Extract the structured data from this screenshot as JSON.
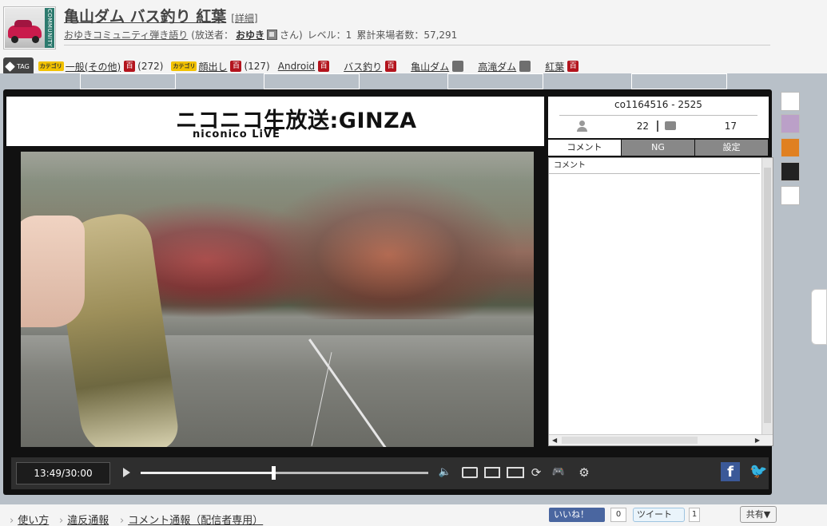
{
  "header": {
    "title": "亀山ダム バス釣り 紅葉",
    "detail_link": "[詳細]",
    "community_name": "おゆきコミュニティ弾き語り",
    "broadcaster_label": "(放送者：",
    "broadcaster_name": "おゆき",
    "broadcaster_suffix": "さん)",
    "level_text": "レベル：1",
    "visitors_text": "累計来場者数：57,291",
    "thumb_band": "COMMUNITY"
  },
  "tags": {
    "tag_label": "TAG",
    "category_badge": "カテゴリ",
    "dict_glyph": "百",
    "items": [
      {
        "label": "一般(その他)",
        "count": "(272)"
      },
      {
        "label": "顔出し",
        "count": "(127)"
      },
      {
        "label": "Android"
      },
      {
        "label": "バス釣り"
      },
      {
        "label": "亀山ダム"
      },
      {
        "label": "高滝ダム"
      },
      {
        "label": "紅葉"
      }
    ]
  },
  "player": {
    "logo_main": "ニコニコ生放送:GINZA",
    "logo_sub": "niconico LiVE",
    "live_id": "co1164516 - 2525",
    "viewers": "22",
    "comments": "17",
    "tabs": [
      "コメント",
      "NG",
      "設定"
    ],
    "comment_column": "コメント",
    "time": "13:49/30:00",
    "progress": 0.46
  },
  "footer": {
    "links": [
      "使い方",
      "違反通報",
      "コメント通報（配信者専用）"
    ],
    "like_label": "いいね！",
    "like_count": "0",
    "tweet_label": "ツイート",
    "tweet_count": "1",
    "share_label": "共有▼"
  },
  "colors": {
    "brand_dark": "#111111",
    "dict_red": "#b3141d",
    "facebook": "#3b5998",
    "twitter": "#4aa8e6"
  }
}
